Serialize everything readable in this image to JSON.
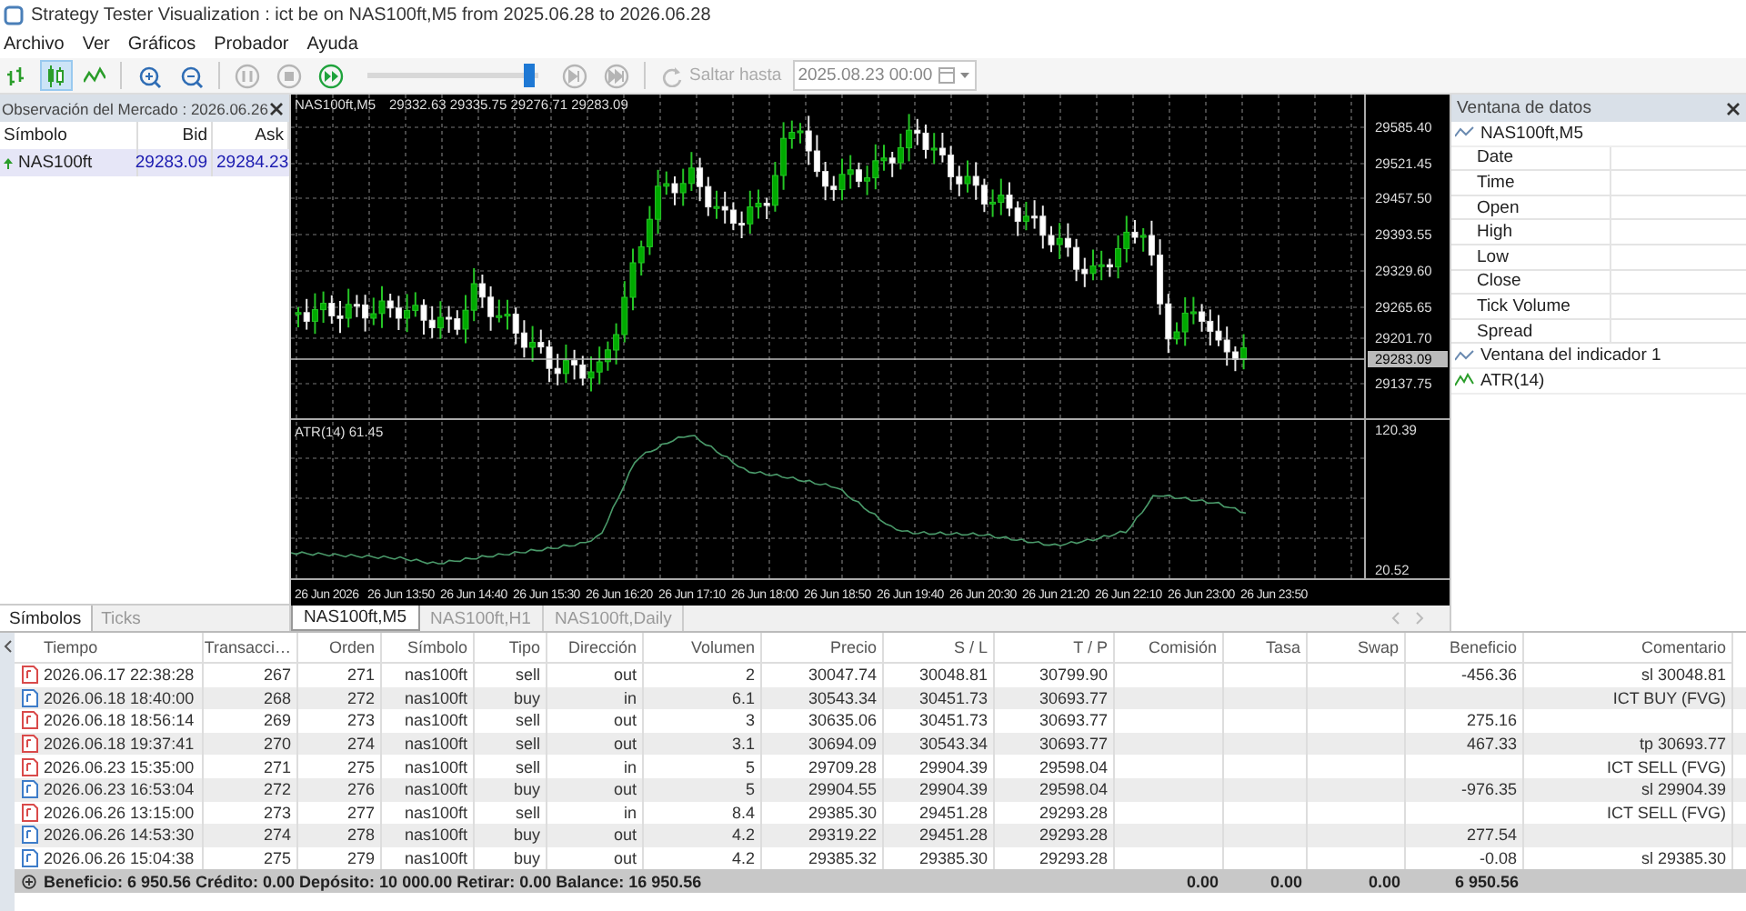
{
  "window": {
    "title": "Strategy Tester Visualization : ict be on NAS100ft,M5 from 2025.06.28 to 2026.06.28"
  },
  "menu": [
    "Archivo",
    "Ver",
    "Gráficos",
    "Probador",
    "Ayuda"
  ],
  "toolbar": {
    "chart_modes": [
      {
        "kind": "bars",
        "selected": false
      },
      {
        "kind": "candles",
        "selected": true
      },
      {
        "kind": "line",
        "selected": false
      }
    ],
    "playback": [
      {
        "kind": "pause",
        "disabled": true
      },
      {
        "kind": "stop",
        "disabled": true
      },
      {
        "kind": "play",
        "disabled": false
      }
    ],
    "speed": {
      "level": 0.95
    },
    "stepping": [
      {
        "kind": "step",
        "disabled": true
      },
      {
        "kind": "end",
        "disabled": true
      }
    ],
    "jump_button": {
      "label": "Saltar hasta",
      "disabled": true
    },
    "jump_date": {
      "value": "2025.08.23 00:00"
    }
  },
  "market_watch": {
    "title": "Observación del Mercado : 2026.06.26",
    "columns": [
      "Símbolo",
      "Bid",
      "Ask"
    ],
    "rows": [
      {
        "symbol": "NAS100ft",
        "bid": "29283.09",
        "ask": "29284.23",
        "selected": true
      }
    ],
    "tabs": [
      {
        "label": "Símbolos",
        "selected": true
      },
      {
        "label": "Ticks",
        "selected": false
      }
    ]
  },
  "chart": {
    "symbol": "NAS100ft,M5",
    "ohlc": "29332.63 29335.75 29276.71 29283.09",
    "price_axis": [
      "29585.40",
      "29521.45",
      "29457.50",
      "29393.55",
      "29329.60",
      "29265.65",
      "29201.70",
      "29137.75"
    ],
    "current_price": "29283.09",
    "indicator": "ATR(14) 61.45",
    "indicator_axis": [
      "120.39",
      "20.52"
    ],
    "time_axis": [
      "26 Jun 2026",
      "26 Jun 13:50",
      "26 Jun 14:40",
      "26 Jun 15:30",
      "26 Jun 16:20",
      "26 Jun 17:10",
      "26 Jun 18:00",
      "26 Jun 18:50",
      "26 Jun 19:40",
      "26 Jun 20:30",
      "26 Jun 21:20",
      "26 Jun 22:10",
      "26 Jun 23:00",
      "26 Jun 23:50"
    ],
    "tabs": [
      {
        "label": "NAS100ft,M5",
        "selected": true
      },
      {
        "label": "NAS100ft,H1",
        "selected": false
      },
      {
        "label": "NAS100ft,Daily",
        "selected": false
      }
    ]
  },
  "data_window": {
    "title": "Ventana de datos",
    "items": [
      {
        "kind": "group",
        "label": "NAS100ft,M5"
      },
      {
        "kind": "field",
        "label": "Date"
      },
      {
        "kind": "field",
        "label": "Time"
      },
      {
        "kind": "field",
        "label": "Open"
      },
      {
        "kind": "field",
        "label": "High"
      },
      {
        "kind": "field",
        "label": "Low"
      },
      {
        "kind": "field",
        "label": "Close"
      },
      {
        "kind": "field",
        "label": "Tick Volume"
      },
      {
        "kind": "field",
        "label": "Spread"
      },
      {
        "kind": "group",
        "label": "Ventana del indicador 1"
      },
      {
        "kind": "indicator",
        "label": "ATR(14)"
      }
    ]
  },
  "deals": {
    "columns": [
      "Tiempo",
      "Transacci…",
      "Orden",
      "Símbolo",
      "Tipo",
      "Dirección",
      "Volumen",
      "Precio",
      "S / L",
      "T / P",
      "Comisión",
      "Tasa",
      "Swap",
      "Beneficio",
      "Comentario"
    ],
    "rows": [
      {
        "color": "#d94a4a",
        "time": "2026.06.17 22:38:28",
        "deal": "267",
        "order": "271",
        "symbol": "nas100ft",
        "type": "sell",
        "direction": "out",
        "volume": "2",
        "price": "30047.74",
        "sl": "30048.81",
        "tp": "30799.90",
        "profit": "-456.36",
        "comment": "sl 30048.81"
      },
      {
        "color": "#3d7cc9",
        "time": "2026.06.18 18:40:00",
        "deal": "268",
        "order": "272",
        "symbol": "nas100ft",
        "type": "buy",
        "direction": "in",
        "volume": "6.1",
        "price": "30543.34",
        "sl": "30451.73",
        "tp": "30693.77",
        "comment": "ICT BUY (FVG)"
      },
      {
        "color": "#d94a4a",
        "time": "2026.06.18 18:56:14",
        "deal": "269",
        "order": "273",
        "symbol": "nas100ft",
        "type": "sell",
        "direction": "out",
        "volume": "3",
        "price": "30635.06",
        "sl": "30451.73",
        "tp": "30693.77",
        "profit": "275.16"
      },
      {
        "color": "#d94a4a",
        "time": "2026.06.18 19:37:41",
        "deal": "270",
        "order": "274",
        "symbol": "nas100ft",
        "type": "sell",
        "direction": "out",
        "volume": "3.1",
        "price": "30694.09",
        "sl": "30543.34",
        "tp": "30693.77",
        "profit": "467.33",
        "comment": "tp 30693.77"
      },
      {
        "color": "#d94a4a",
        "time": "2026.06.23 15:35:00",
        "deal": "271",
        "order": "275",
        "symbol": "nas100ft",
        "type": "sell",
        "direction": "in",
        "volume": "5",
        "price": "29709.28",
        "sl": "29904.39",
        "tp": "29598.04",
        "comment": "ICT SELL (FVG)"
      },
      {
        "color": "#3d7cc9",
        "time": "2026.06.23 16:53:04",
        "deal": "272",
        "order": "276",
        "symbol": "nas100ft",
        "type": "buy",
        "direction": "out",
        "volume": "5",
        "price": "29904.55",
        "sl": "29904.39",
        "tp": "29598.04",
        "profit": "-976.35",
        "comment": "sl 29904.39"
      },
      {
        "color": "#d94a4a",
        "time": "2026.06.26 13:15:00",
        "deal": "273",
        "order": "277",
        "symbol": "nas100ft",
        "type": "sell",
        "direction": "in",
        "volume": "8.4",
        "price": "29385.30",
        "sl": "29451.28",
        "tp": "29293.28",
        "comment": "ICT SELL (FVG)"
      },
      {
        "color": "#3d7cc9",
        "time": "2026.06.26 14:53:30",
        "deal": "274",
        "order": "278",
        "symbol": "nas100ft",
        "type": "buy",
        "direction": "out",
        "volume": "4.2",
        "price": "29319.22",
        "sl": "29451.28",
        "tp": "29293.28",
        "profit": "277.54"
      },
      {
        "color": "#3d7cc9",
        "time": "2026.06.26 15:04:38",
        "deal": "275",
        "order": "279",
        "symbol": "nas100ft",
        "type": "buy",
        "direction": "out",
        "volume": "4.2",
        "price": "29385.32",
        "sl": "29385.30",
        "tp": "29293.28",
        "profit": "-0.08",
        "comment": "sl 29385.30"
      }
    ],
    "summary": "Beneficio: 6 950.56  Crédito: 0.00  Depósito: 10 000.00  Retirar: 0.00  Balance: 16 950.56",
    "totals": {
      "commission": "0.00",
      "fee": "0.00",
      "swap": "0.00",
      "profit": "6 950.56"
    }
  }
}
